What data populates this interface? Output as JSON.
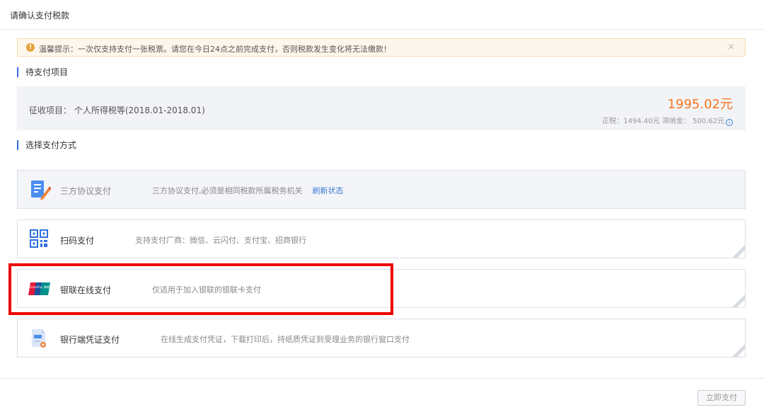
{
  "header": {
    "title": "请确认支付税款"
  },
  "notice": {
    "icon_glyph": "!",
    "text": "温馨提示：一次仅支持支付一张税票。请您在今日24点之前完成支付，否则税款发生变化将无法缴款！",
    "close_glyph": "×"
  },
  "pending": {
    "section_title": "待支付项目",
    "label": "征收项目： 个人所得税等(2018.01-2018.01)",
    "amount": "1995.02元",
    "detail": "正税：1494.40元   滞纳金： 500.62元"
  },
  "payment": {
    "section_title": "选择支付方式",
    "options": [
      {
        "name": "三方协议支付",
        "desc": "三方协议支付,必须是相同税款所属税务机关",
        "link": "刷新状态",
        "icon": "document-pen-icon",
        "disabled": true
      },
      {
        "name": "扫码支付",
        "desc": "支持支付厂商：微信、云闪付、支付宝、招商银行",
        "icon": "qr-code-icon",
        "disabled": false
      },
      {
        "name": "银联在线支付",
        "desc": "仅适用于加入银联的银联卡支付",
        "icon": "unionpay-card-icon",
        "disabled": false
      },
      {
        "name": "银行端凭证支付",
        "desc": "在线生成支付凭证，下载打印后，持纸质凭证到受理业务的银行窗口支付",
        "icon": "bank-voucher-icon",
        "disabled": false
      }
    ]
  },
  "unionpay_logo_text": "UnionPay 银联",
  "footer": {
    "submit_label": "立即支付"
  },
  "colors": {
    "accent": "#2f6fe0",
    "amount": "#f7761f",
    "warning": "#e6a23c",
    "highlight": "#ee0000"
  }
}
